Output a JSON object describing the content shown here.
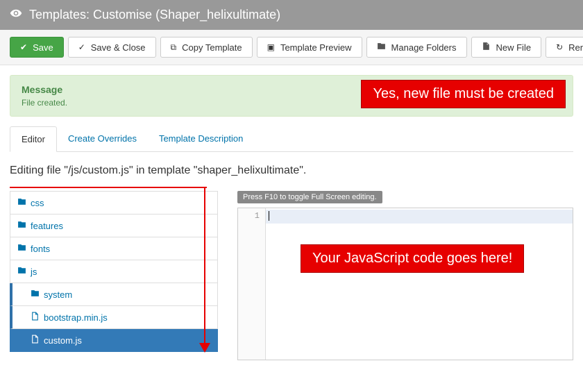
{
  "header": {
    "title": "Templates: Customise (Shaper_helixultimate)"
  },
  "toolbar": {
    "save": "Save",
    "saveClose": "Save & Close",
    "copy": "Copy Template",
    "preview": "Template Preview",
    "folders": "Manage Folders",
    "newFile": "New File",
    "rename": "Rename F"
  },
  "alert": {
    "title": "Message",
    "msg": "File created."
  },
  "annot1": "Yes, new file must be created",
  "annot2": "Your JavaScript code goes here!",
  "tabs": {
    "editor": "Editor",
    "overrides": "Create Overrides",
    "desc": "Template Description"
  },
  "editing": "Editing file \"/js/custom.js\" in template \"shaper_helixultimate\".",
  "tree": {
    "css": "css",
    "features": "features",
    "fonts": "fonts",
    "js": "js",
    "system": "system",
    "bootstrap": "bootstrap.min.js",
    "custom": "custom.js"
  },
  "editor": {
    "hint": "Press F10 to toggle Full Screen editing.",
    "line1": "1"
  }
}
